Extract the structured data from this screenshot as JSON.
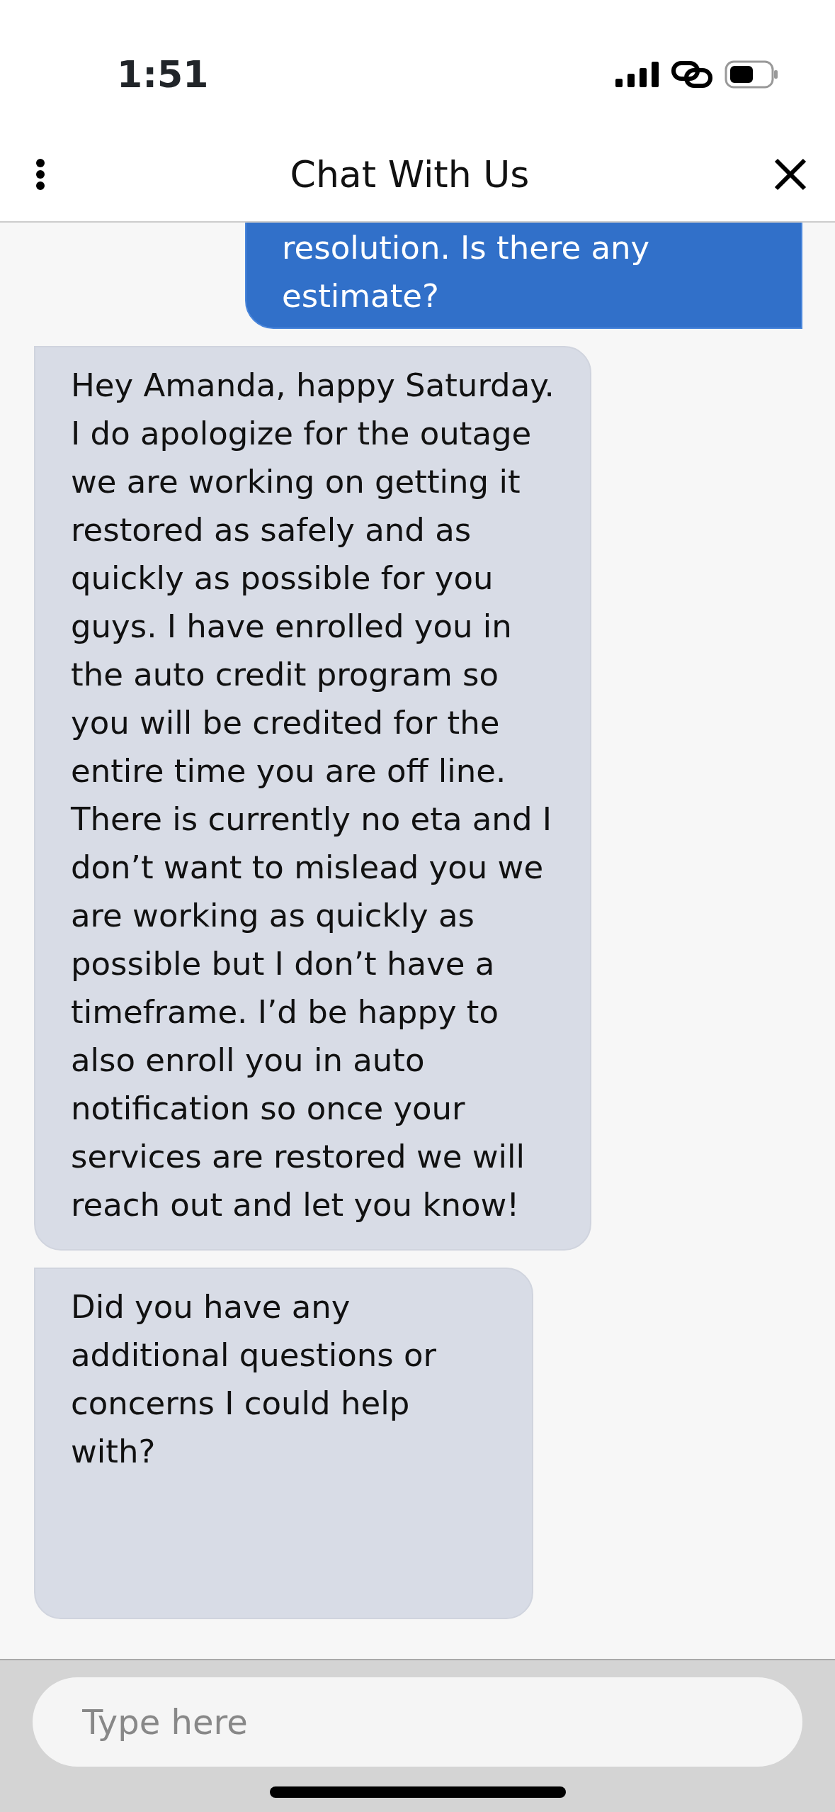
{
  "status_bar": {
    "time": "1:51"
  },
  "header": {
    "title": "Chat With Us"
  },
  "messages": [
    {
      "kind": "sent",
      "text": "resolution. Is there any estimate?"
    },
    {
      "kind": "received",
      "text": "Hey Amanda, happy Saturday. I do apologize for the outage we are working on getting it restored as safely and as quickly as possible for you guys. I have enrolled you in the auto credit program so you will be credited for the entire time you are off line. There is currently no eta and I don’t want to mislead you we are working as quickly as possible but I don’t have a timeframe. I’d be happy to also enroll you in auto notification so once your services are restored we will reach out and let you know!"
    },
    {
      "kind": "received",
      "text": "Did you have any additional questions or concerns I could help with?"
    }
  ],
  "composer": {
    "placeholder": "Type here"
  }
}
